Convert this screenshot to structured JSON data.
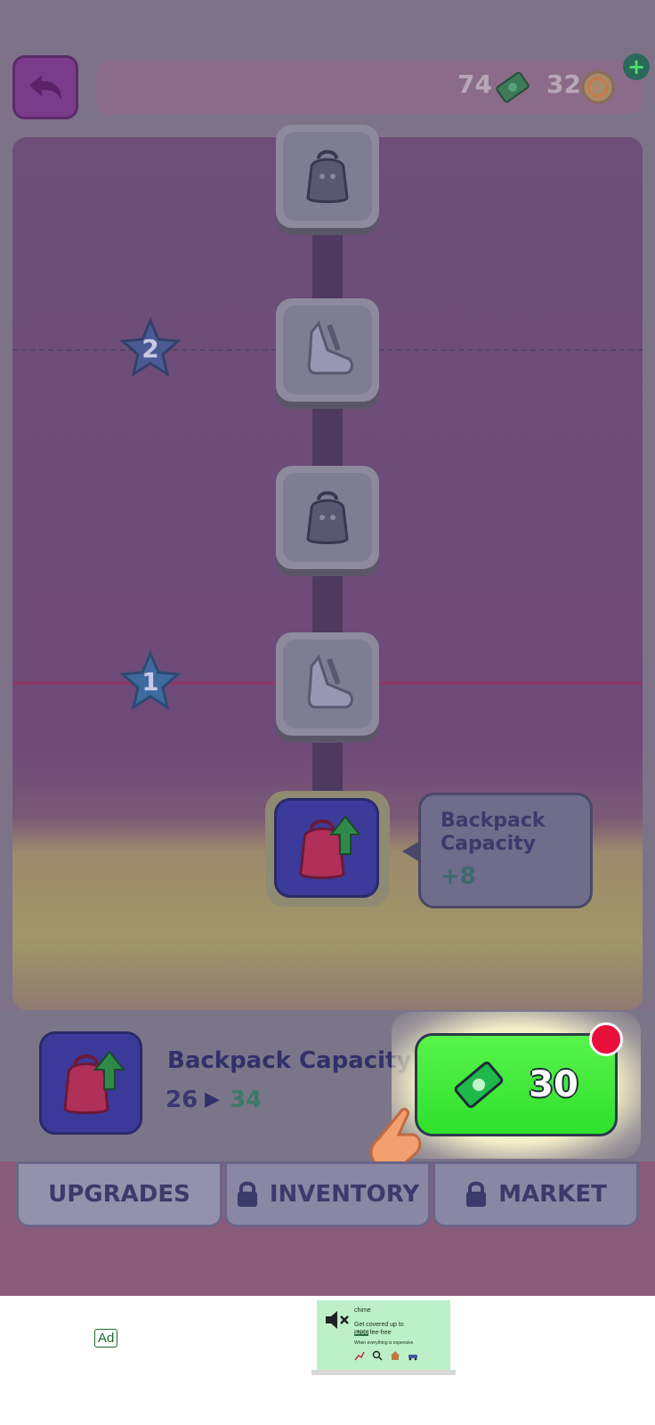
{
  "header": {
    "cash_count": "74",
    "coin_count": "32",
    "plus_label": "+"
  },
  "board": {
    "stars": [
      {
        "label": "2"
      },
      {
        "label": "1"
      }
    ],
    "nodes": [
      {
        "icon": "backpack-icon"
      },
      {
        "icon": "boot-icon"
      },
      {
        "icon": "backpack-icon"
      },
      {
        "icon": "boot-icon"
      }
    ],
    "active_node": {
      "icon": "backpack-upgrade-icon"
    },
    "tooltip": {
      "title": "Backpack Capacity",
      "value": "+8"
    }
  },
  "upgrade_panel": {
    "title": "Backpack Capacity",
    "level_from": "26",
    "level_to": "34",
    "price": "30"
  },
  "tabs": [
    {
      "label": "UPGRADES",
      "locked": false
    },
    {
      "label": "INVENTORY",
      "locked": true
    },
    {
      "label": "MARKET",
      "locked": true
    }
  ],
  "ad": {
    "badge": "Ad",
    "brand": "chime",
    "headline_1": "Get covered up to",
    "headline_2": "$200",
    "headline_3": " fee-free",
    "subline": "When everything is expensive"
  },
  "colors": {
    "buy_button": "#3ee63a",
    "notification_dot": "#e8103a",
    "cash_icon": "#2f8a4a"
  }
}
